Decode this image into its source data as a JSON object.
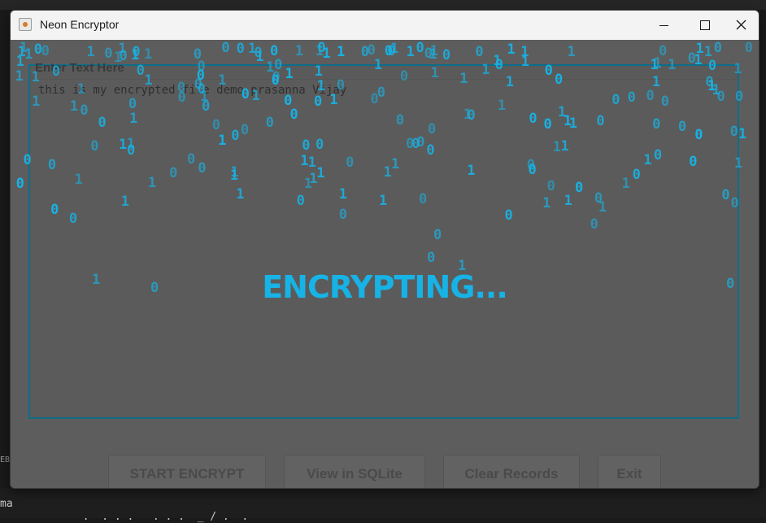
{
  "window": {
    "title": "Neon Encryptor"
  },
  "form": {
    "label": "Enter Text Here",
    "text": "this is my encrypted file demo prasanna Vijay"
  },
  "buttons": {
    "start": "START ENCRYPT",
    "view": "View in SQLite",
    "clear": "Clear Records",
    "exit": "Exit"
  },
  "overlay": {
    "message": "ENCRYPTING...",
    "accent_color": "#17b3e6"
  },
  "background": {
    "line1": "ma",
    "line2": "             .  . . .   . . .  _ / .  .",
    "line3": "EB"
  }
}
